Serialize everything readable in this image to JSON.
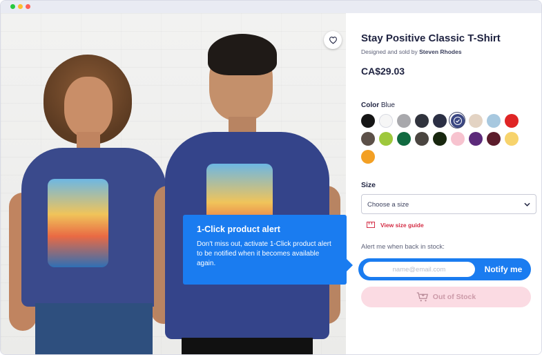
{
  "window": {
    "controls": [
      "close",
      "minimize",
      "maximize"
    ]
  },
  "product": {
    "title": "Stay Positive Classic T-Shirt",
    "designed_prefix": "Designed and sold by",
    "designer": "Steven Rhodes",
    "price": "CA$29.03",
    "favorite_icon": "heart-icon"
  },
  "color": {
    "label": "Color",
    "selected_name": "Blue",
    "swatches": [
      {
        "hex": "#151515"
      },
      {
        "hex": "#f6f6f6"
      },
      {
        "hex": "#a8a8ac"
      },
      {
        "hex": "#30333d"
      },
      {
        "hex": "#2b2f44"
      },
      {
        "hex": "#3b4783",
        "selected": true
      },
      {
        "hex": "#e3d3c3"
      },
      {
        "hex": "#a7c8df"
      },
      {
        "hex": "#df2525"
      },
      {
        "hex": "#5c5048"
      },
      {
        "hex": "#9ec83c"
      },
      {
        "hex": "#116a40"
      },
      {
        "hex": "#4a4540"
      },
      {
        "hex": "#18270f"
      },
      {
        "hex": "#f7c3cf"
      },
      {
        "hex": "#5c2a7a"
      },
      {
        "hex": "#5b1c2b"
      },
      {
        "hex": "#f7d36c"
      },
      {
        "hex": "#f3a024"
      }
    ]
  },
  "size": {
    "label": "Size",
    "select_placeholder": "Choose a size",
    "guide_link": "View size guide"
  },
  "stock_alert": {
    "label": "Alert me when back in stock:",
    "email_placeholder": "name@email.com",
    "notify_button": "Notify me",
    "out_of_stock_button": "Out of Stock"
  },
  "tooltip": {
    "title": "1-Click product alert",
    "body": "Don't miss out, activate 1-Click product alert to be notified when it becomes available again."
  },
  "colors": {
    "accent": "#1a7cf0",
    "out_of_stock_bg": "#fbdbe3",
    "size_guide": "#d42d45"
  }
}
